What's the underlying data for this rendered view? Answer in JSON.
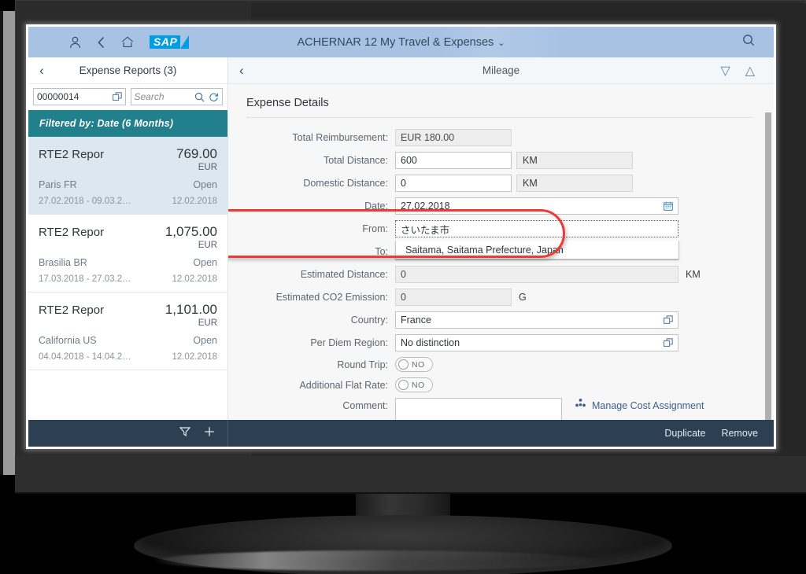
{
  "shell": {
    "title": "ACHERNAR 12 My Travel & Expenses",
    "title_chevron": "⌄",
    "logo": "SAP",
    "icons": {
      "user": "user-icon",
      "back": "back-icon",
      "home": "home-icon",
      "search": "search-icon"
    }
  },
  "master": {
    "back_label": "‹",
    "title": "Expense Reports (3)",
    "id_field_value": "00000014",
    "search_placeholder": "Search",
    "filter_banner": "Filtered by: Date (6 Months)",
    "items": [
      {
        "title": "RTE2 Repor",
        "amount": "769.00",
        "currency": "EUR",
        "location": "Paris FR",
        "status": "Open",
        "date_range": "27.02.2018 - 09.03.2…",
        "date": "12.02.2018",
        "selected": true
      },
      {
        "title": "RTE2 Repor",
        "amount": "1,075.00",
        "currency": "EUR",
        "location": "Brasilia BR",
        "status": "Open",
        "date_range": "17.03.2018 - 27.03.2…",
        "date": "12.02.2018",
        "selected": false
      },
      {
        "title": "RTE2 Repor",
        "amount": "1,101.00",
        "currency": "EUR",
        "location": "California US",
        "status": "Open",
        "date_range": "04.04.2018 - 14.04.2…",
        "date": "12.02.2018",
        "selected": false
      }
    ],
    "footer": {
      "filter_icon": "filter-icon",
      "add_icon": "plus-icon"
    }
  },
  "detail": {
    "back_label": "‹",
    "title": "Mileage",
    "nav_down": "▽",
    "nav_up": "△",
    "section_title": "Expense Details",
    "fields": {
      "total_reimbursement": {
        "label": "Total Reimbursement:",
        "value": "EUR 180.00"
      },
      "total_distance": {
        "label": "Total Distance:",
        "value": "600",
        "unit": "KM"
      },
      "domestic_distance": {
        "label": "Domestic Distance:",
        "value": "0",
        "unit": "KM"
      },
      "date": {
        "label": "Date:",
        "value": "27.02.2018",
        "icon": "calendar-icon"
      },
      "from": {
        "label": "From:",
        "value": "さいたま市"
      },
      "to": {
        "label": "To:",
        "value": ""
      },
      "suggestion": "Saitama, Saitama Prefecture, Japan",
      "estimated_distance": {
        "label": "Estimated Distance:",
        "value": "0",
        "unit": "KM"
      },
      "estimated_co2": {
        "label": "Estimated CO2 Emission:",
        "value": "0",
        "unit": "G"
      },
      "country": {
        "label": "Country:",
        "value": "France",
        "icon": "value-help-icon"
      },
      "per_diem_region": {
        "label": "Per Diem Region:",
        "value": "No distinction",
        "icon": "value-help-icon"
      },
      "round_trip": {
        "label": "Round Trip:",
        "value": "NO"
      },
      "additional_flat_rate": {
        "label": "Additional Flat Rate:",
        "value": "NO"
      },
      "comment": {
        "label": "Comment:",
        "value": ""
      }
    },
    "manage_cost_assignment": "Manage Cost Assignment"
  },
  "footer": {
    "duplicate": "Duplicate",
    "remove": "Remove"
  },
  "colors": {
    "shell_header": "#a8c2e4",
    "filter_banner": "#22808d",
    "footer_bar": "#2d3f52",
    "annotation": "#ec3b35",
    "sap_blue": "#009de0",
    "selected_row": "#dde7f0"
  }
}
